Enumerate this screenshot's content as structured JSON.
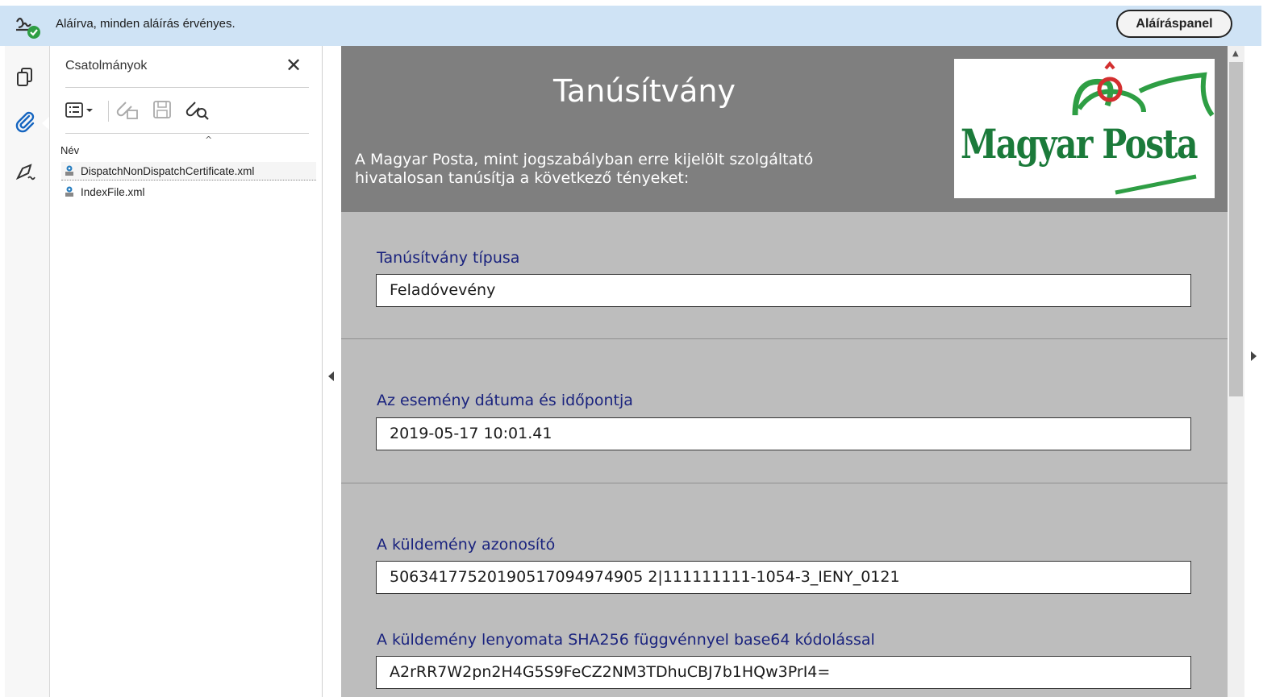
{
  "signature_bar": {
    "status_text": "Aláírva, minden aláírás érvényes.",
    "panel_button": "Aláíráspanel"
  },
  "attachments": {
    "title": "Csatolmányok",
    "close_glyph": "✕",
    "column_header": "Név",
    "sort_glyph": "^",
    "files": [
      {
        "name": "DispatchNonDispatchCertificate.xml",
        "selected": true
      },
      {
        "name": "IndexFile.xml",
        "selected": false
      }
    ],
    "toolbar_icons": [
      "options-icon",
      "open-attachment-icon",
      "save-attachment-icon",
      "search-attachment-icon"
    ]
  },
  "rail_icons": [
    "pages-icon",
    "attachment-clip-icon",
    "signature-pen-icon"
  ],
  "document": {
    "title": "Tanúsítvány",
    "intro_line1": "A Magyar Posta, mint jogszabályban erre kijelölt szolgáltató",
    "intro_line2": "hivatalosan tanúsítja a következő tényeket:",
    "logo_text": "Magyar Posta",
    "fields": [
      {
        "label": "Tanúsítvány típusa",
        "value": "Feladóvevény"
      },
      {
        "label": "Az esemény dátuma és időpontja",
        "value": "2019-05-17 10:01.41"
      },
      {
        "label": "A küldemény azonosító",
        "value": "50634177520190517094974905 2|111111111-1054-3_IENY_0121"
      },
      {
        "label": "A küldemény lenyomata SHA256 függvénnyel base64 kódolással",
        "value": "A2rRR7W2pn2H4G5S9FeCZ2NM3TDhuCBJ7b1HQw3PrI4="
      }
    ]
  },
  "colors": {
    "signature_bar": "#cfe3f5",
    "doc_header": "#7f7f7f",
    "doc_body": "#bdbdbd",
    "label_blue": "#1a237e",
    "logo_green": "#1b7a3a",
    "logo_red": "#d32f2f",
    "rail_accent_blue": "#1565c0"
  }
}
